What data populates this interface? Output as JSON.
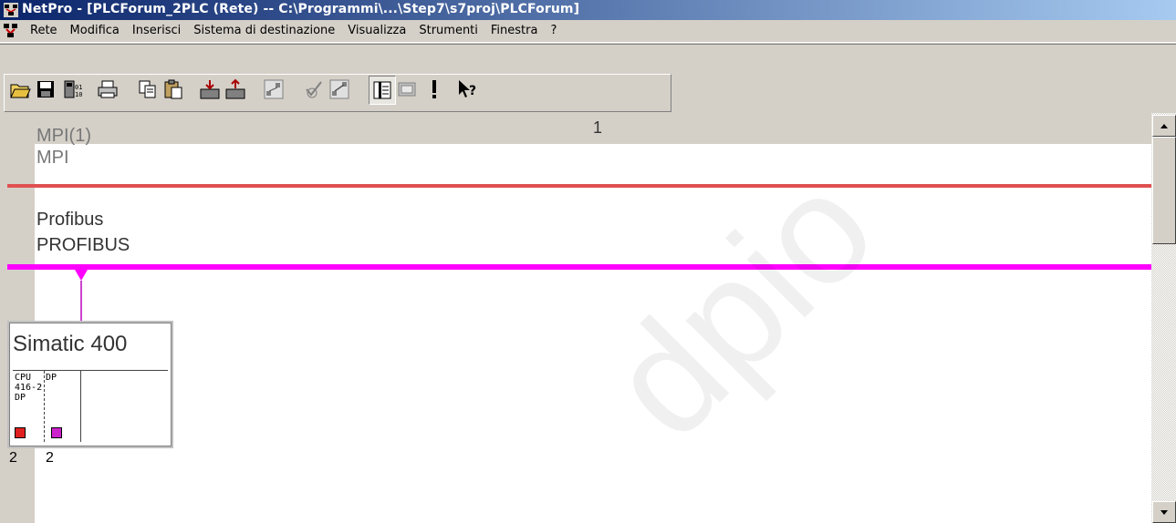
{
  "window": {
    "title": "NetPro - [PLCForum_2PLC (Rete) -- C:\\Programmi\\...\\Step7\\s7proj\\PLCForum]"
  },
  "menu": {
    "items": [
      "Rete",
      "Modifica",
      "Inserisci",
      "Sistema di destinazione",
      "Visualizza",
      "Strumenti",
      "Finestra",
      "?"
    ]
  },
  "toolbar": {
    "buttons": [
      {
        "icon": "open-folder-icon"
      },
      {
        "icon": "save-icon"
      },
      {
        "icon": "network-config-icon"
      },
      {
        "icon": "print-icon"
      },
      {
        "icon": "copy-icon"
      },
      {
        "icon": "paste-icon"
      },
      {
        "icon": "download-icon"
      },
      {
        "icon": "upload-icon"
      },
      {
        "icon": "configure-network-icon"
      },
      {
        "icon": "consistency-check-icon"
      },
      {
        "icon": "link-icon"
      },
      {
        "icon": "catalog-icon"
      },
      {
        "icon": "zoom-icon"
      },
      {
        "icon": "exclamation-icon"
      },
      {
        "icon": "help-pointer-icon"
      }
    ]
  },
  "canvas": {
    "column_number": "1",
    "networks": [
      {
        "name": "MPI(1)",
        "type": "MPI",
        "color": "#e05050"
      },
      {
        "name": "Profibus",
        "type": "PROFIBUS",
        "color": "#ff00ff"
      }
    ],
    "station": {
      "name": "Simatic 400",
      "slot1": "CPU\n416-2\nDP",
      "slot2": "DP",
      "address_1": "2",
      "address_2": "2"
    }
  },
  "watermark": "dpio"
}
